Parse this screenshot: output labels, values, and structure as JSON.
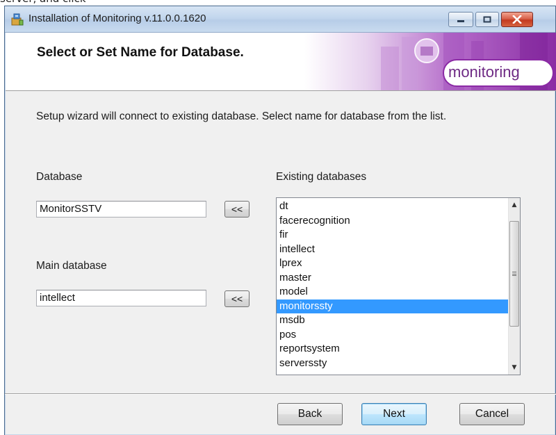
{
  "crop_text": "server, and click",
  "window": {
    "title": "Installation of Monitoring v.11.0.0.1620"
  },
  "header": {
    "title": "Select or Set Name for Database.",
    "logo_text": "monitoring"
  },
  "body": {
    "description": "Setup wizard will connect to existing database. Select name for database from the list."
  },
  "database": {
    "label": "Database",
    "value": "MonitorSSTV",
    "pick_label": "<<"
  },
  "main_database": {
    "label": "Main database",
    "value": "intellect",
    "pick_label": "<<"
  },
  "existing": {
    "label": "Existing databases",
    "items": [
      "dt",
      "facerecognition",
      "fir",
      "intellect",
      "lprex",
      "master",
      "model",
      "monitorssty",
      "msdb",
      "pos",
      "reportsystem",
      "serverssty"
    ],
    "selected_index": 7
  },
  "buttons": {
    "back": "Back",
    "next": "Next",
    "cancel": "Cancel"
  },
  "colors": {
    "selection": "#3399ff",
    "header_art": "#9b3fb0"
  }
}
